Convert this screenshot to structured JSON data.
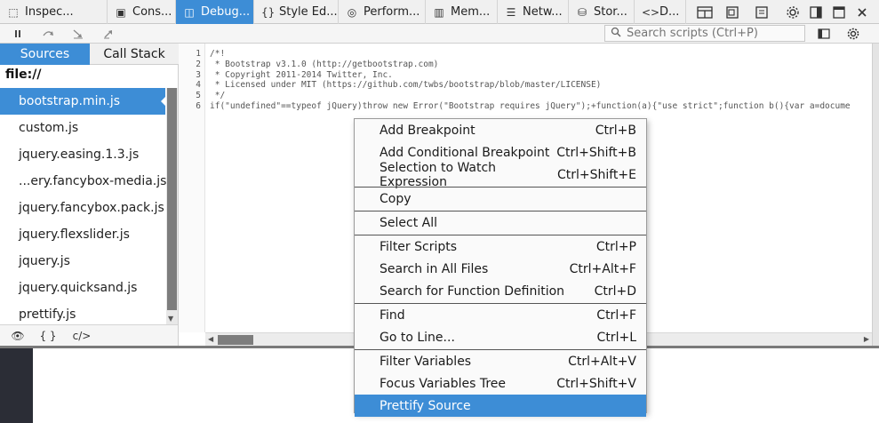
{
  "tabs": [
    {
      "label": "Inspec...",
      "icon": "inspector-icon"
    },
    {
      "label": "Cons...",
      "icon": "console-icon"
    },
    {
      "label": "Debug...",
      "icon": "debugger-icon",
      "selected": true
    },
    {
      "label": "Style Ed...",
      "icon": "style-editor-icon"
    },
    {
      "label": "Perform...",
      "icon": "performance-icon"
    },
    {
      "label": "Mem...",
      "icon": "memory-icon"
    },
    {
      "label": "Netw...",
      "icon": "network-icon"
    },
    {
      "label": "Stor...",
      "icon": "storage-icon"
    },
    {
      "label": "D...",
      "icon": "dom-icon"
    }
  ],
  "toolbar_right_icons": [
    "frames-icon",
    "responsive-icon",
    "options-icon",
    "dock-icon",
    "popout-icon",
    "close-icon"
  ],
  "debugger_toolbar": {
    "buttons": [
      "pause-icon",
      "step-over-icon",
      "step-in-icon",
      "step-out-icon"
    ],
    "search_placeholder": "Search scripts (Ctrl+P)",
    "right_icons": [
      "toggle-pane-icon",
      "settings-icon"
    ]
  },
  "sources": {
    "tabs": [
      {
        "label": "Sources",
        "selected": true
      },
      {
        "label": "Call Stack"
      }
    ],
    "root": "file://",
    "files": [
      {
        "label": "bootstrap.min.js",
        "selected": true
      },
      {
        "label": "custom.js"
      },
      {
        "label": "jquery.easing.1.3.js"
      },
      {
        "label": "...ery.fancybox-media.js"
      },
      {
        "label": "jquery.fancybox.pack.js"
      },
      {
        "label": "jquery.flexslider.js"
      },
      {
        "label": "jquery.js"
      },
      {
        "label": "jquery.quicksand.js"
      },
      {
        "label": "prettify.js"
      }
    ],
    "footer": {
      "blackbox_glyph": "👁",
      "pretty_glyph": "{ }",
      "source_glyph": "c/>"
    }
  },
  "editor": {
    "line_numbers": [
      "1",
      "2",
      "3",
      "4",
      "5",
      "6"
    ],
    "lines": [
      "/*!",
      " * Bootstrap v3.1.0 (http://getbootstrap.com)",
      " * Copyright 2011-2014 Twitter, Inc.",
      " * Licensed under MIT (https://github.com/twbs/bootstrap/blob/master/LICENSE)",
      " */",
      "if(\"undefined\"==typeof jQuery)throw new Error(\"Bootstrap requires jQuery\");+function(a){\"use strict\";function b(){var a=docume"
    ]
  },
  "context_menu": {
    "groups": [
      [
        {
          "label": "Add Breakpoint",
          "shortcut": "Ctrl+B"
        },
        {
          "label": "Add Conditional Breakpoint",
          "shortcut": "Ctrl+Shift+B"
        },
        {
          "label": "Selection to Watch Expression",
          "shortcut": "Ctrl+Shift+E"
        }
      ],
      [
        {
          "label": "Copy",
          "shortcut": ""
        }
      ],
      [
        {
          "label": "Select All",
          "shortcut": ""
        }
      ],
      [
        {
          "label": "Filter Scripts",
          "shortcut": "Ctrl+P"
        },
        {
          "label": "Search in All Files",
          "shortcut": "Ctrl+Alt+F"
        },
        {
          "label": "Search for Function Definition",
          "shortcut": "Ctrl+D"
        }
      ],
      [
        {
          "label": "Find",
          "shortcut": "Ctrl+F"
        },
        {
          "label": "Go to Line...",
          "shortcut": "Ctrl+L"
        }
      ],
      [
        {
          "label": "Filter Variables",
          "shortcut": "Ctrl+Alt+V"
        },
        {
          "label": "Focus Variables Tree",
          "shortcut": "Ctrl+Shift+V"
        },
        {
          "label": "Prettify Source",
          "shortcut": "",
          "highlighted": true
        }
      ]
    ]
  },
  "colors": {
    "accent": "#3d8dd6",
    "page_sidebar": "#2b2d36"
  }
}
